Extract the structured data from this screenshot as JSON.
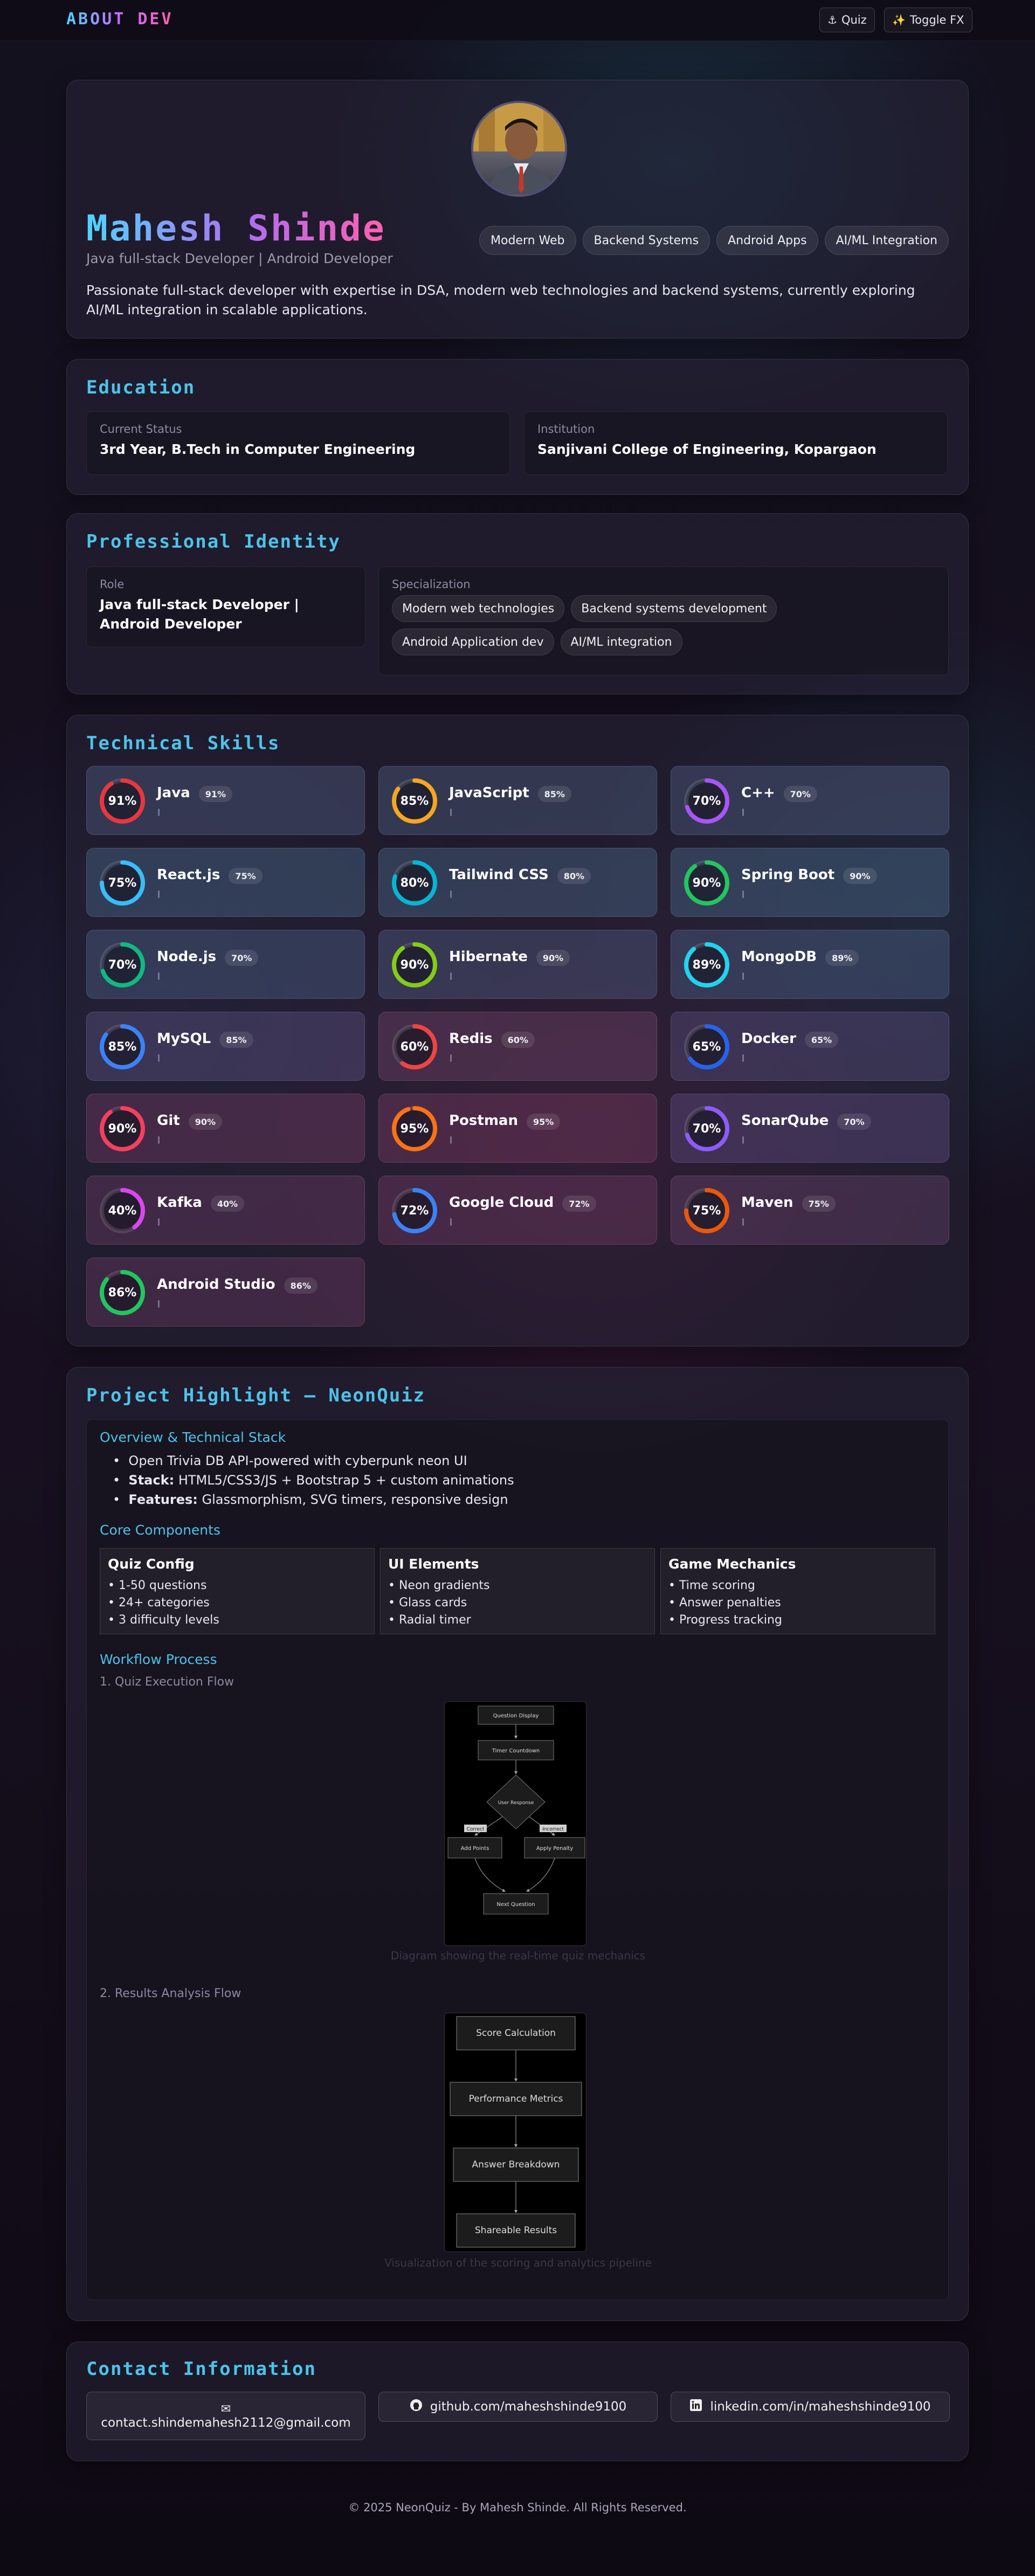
{
  "nav": {
    "brand": "ABOUT DEV",
    "quiz_label": "Quiz",
    "toggle_label": "Toggle FX"
  },
  "hero": {
    "name": "Mahesh Shinde",
    "subtitle": "Java full-stack Developer | Android Developer",
    "chips": [
      "Modern Web",
      "Backend Systems",
      "Android Apps",
      "AI/ML Integration"
    ],
    "bio": "Passionate full-stack developer with expertise in DSA, modern web technologies and backend systems, currently exploring AI/ML integration in scalable applications."
  },
  "education": {
    "title": "Education",
    "status_label": "Current Status",
    "status_value": "3rd Year, B.Tech in Computer Engineering",
    "institution_label": "Institution",
    "institution_value": "Sanjivani College of Engineering, Kopargaon"
  },
  "identity": {
    "title": "Professional Identity",
    "role_label": "Role",
    "role_value": "Java full-stack Developer | Android Developer",
    "spec_label": "Specialization",
    "spec_chips": [
      "Modern web technologies",
      "Backend systems development",
      "Android Application dev",
      "AI/ML integration"
    ]
  },
  "skills": {
    "title": "Technical Skills",
    "items": [
      {
        "name": "Java",
        "pct": 91,
        "color": "#e8373f"
      },
      {
        "name": "JavaScript",
        "pct": 85,
        "color": "#f5a623"
      },
      {
        "name": "C++",
        "pct": 70,
        "color": "#a855f7"
      },
      {
        "name": "React.js",
        "pct": 75,
        "color": "#38bdf8"
      },
      {
        "name": "Tailwind CSS",
        "pct": 80,
        "color": "#06b6d4"
      },
      {
        "name": "Spring Boot",
        "pct": 90,
        "color": "#22c55e"
      },
      {
        "name": "Node.js",
        "pct": 70,
        "color": "#10b981"
      },
      {
        "name": "Hibernate",
        "pct": 90,
        "color": "#84cc16"
      },
      {
        "name": "MongoDB",
        "pct": 89,
        "color": "#22d3ee"
      },
      {
        "name": "MySQL",
        "pct": 85,
        "color": "#3b82f6"
      },
      {
        "name": "Redis",
        "pct": 60,
        "color": "#ef4444"
      },
      {
        "name": "Docker",
        "pct": 65,
        "color": "#2563eb"
      },
      {
        "name": "Git",
        "pct": 90,
        "color": "#f43f5e"
      },
      {
        "name": "Postman",
        "pct": 95,
        "color": "#f97316"
      },
      {
        "name": "SonarQube",
        "pct": 70,
        "color": "#8b5cf6"
      },
      {
        "name": "Kafka",
        "pct": 40,
        "color": "#d946ef"
      },
      {
        "name": "Google Cloud",
        "pct": 72,
        "color": "#3b82f6"
      },
      {
        "name": "Maven",
        "pct": 75,
        "color": "#ea580c"
      },
      {
        "name": "Android Studio",
        "pct": 86,
        "color": "#22c55e"
      }
    ]
  },
  "project": {
    "title": "Project Highlight — NeonQuiz",
    "overview_heading": "Overview & Technical Stack",
    "bullet1": "Open Trivia DB API-powered with cyberpunk neon UI",
    "bullet2_label": "Stack:",
    "bullet2_value": "HTML5/CSS3/JS + Bootstrap 5 + custom animations",
    "bullet3_label": "Features:",
    "bullet3_value": "Glassmorphism, SVG timers, responsive design",
    "core_heading": "Core Components",
    "components": [
      {
        "title": "Quiz Config",
        "items": [
          "• 1-50 questions",
          "• 24+ categories",
          "• 3 difficulty levels"
        ]
      },
      {
        "title": "UI Elements",
        "items": [
          "• Neon gradients",
          "• Glass cards",
          "• Radial timer"
        ]
      },
      {
        "title": "Game Mechanics",
        "items": [
          "• Time scoring",
          "• Answer penalties",
          "• Progress tracking"
        ]
      }
    ],
    "workflow_heading": "Workflow Process",
    "flow1_label": "1. Quiz Execution Flow",
    "flow1": {
      "question_display": "Question Display",
      "timer": "Timer Countdown",
      "user_response": "User Response",
      "correct": "Correct",
      "incorrect": "Incorrect",
      "add_points": "Add Points",
      "apply_penalty": "Apply Penalty",
      "next_question": "Next Question"
    },
    "flow1_caption": "Diagram showing the real-time quiz mechanics",
    "flow2_label": "2. Results Analysis Flow",
    "flow2": {
      "score": "Score Calculation",
      "metrics": "Performance Metrics",
      "breakdown": "Answer Breakdown",
      "shareable": "Shareable Results"
    },
    "flow2_caption": "Visualization of the scoring and analytics pipeline"
  },
  "contact": {
    "title": "Contact Information",
    "email": "contact.shindemahesh2112@gmail.com",
    "github": "github.com/maheshshinde9100",
    "linkedin": "linkedin.com/in/maheshshinde9100"
  },
  "footer": {
    "text": "© 2025 NeonQuiz - By Mahesh Shinde. All Rights Reserved."
  }
}
